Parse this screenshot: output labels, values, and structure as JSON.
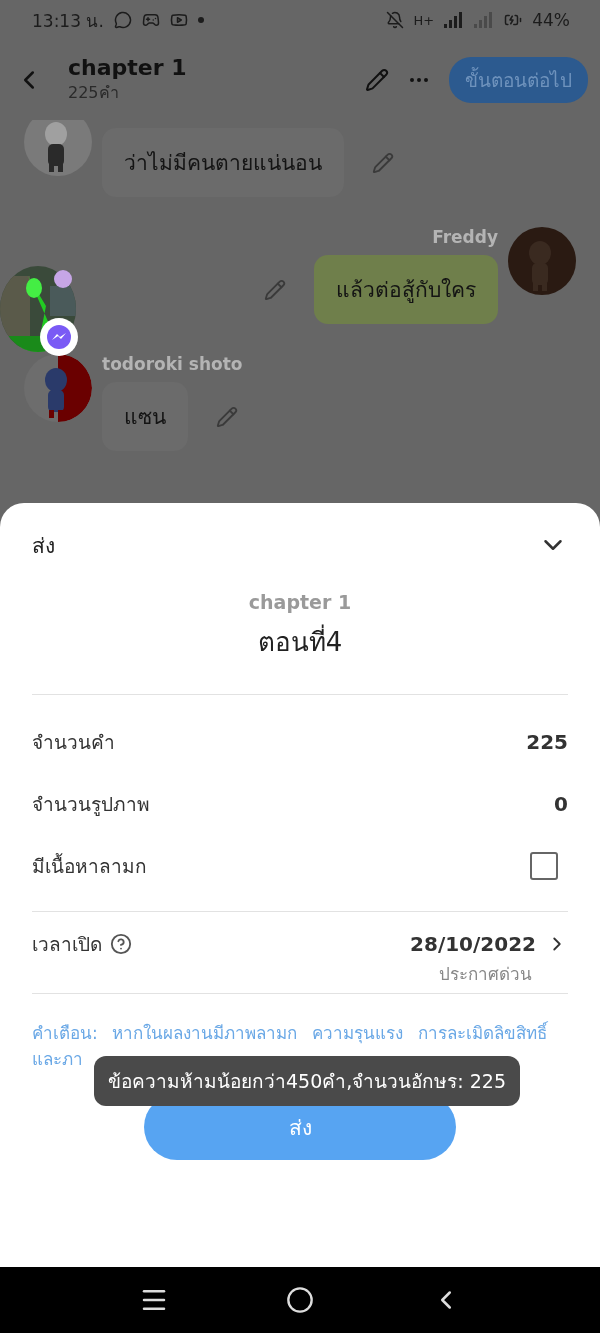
{
  "status_bar": {
    "time": "13:13 น.",
    "network": "H+",
    "battery": "44%"
  },
  "header": {
    "title": "chapter 1",
    "subtitle": "225คำ",
    "next_button": "ขั้นตอนต่อไป"
  },
  "messages": [
    {
      "text": "ว่าไม่มีคนตายแน่นอน",
      "kind": "incoming"
    },
    {
      "sender": "Freddy",
      "text": "แล้วต่อสู้กับใคร",
      "kind": "outgoing"
    },
    {
      "sender": "todoroki shoto",
      "text": "แซน",
      "kind": "incoming"
    }
  ],
  "sheet": {
    "title": "ส่ง",
    "chapter": "chapter 1",
    "episode": "ตอนที่4",
    "rows": [
      {
        "kind": "value",
        "label": "จำนวนคำ",
        "value": "225"
      },
      {
        "kind": "value",
        "label": "จำนวนรูปภาพ",
        "value": "0"
      },
      {
        "kind": "checkbox",
        "label": "มีเนื้อหาลามก",
        "checked": false
      }
    ],
    "schedule": {
      "label": "เวลาเปิด",
      "date": "28/10/2022",
      "note": "ประกาศด่วน"
    },
    "warning": "คำเตือน: หากในผลงานมีภาพลามก ความรุนแรง การละเมิดลิขสิทธิ์ และภา",
    "toast": "ข้อความห้ามน้อยกว่า450คำ,จำนวนอักษร: 225",
    "submit_button": "ส่ง"
  }
}
